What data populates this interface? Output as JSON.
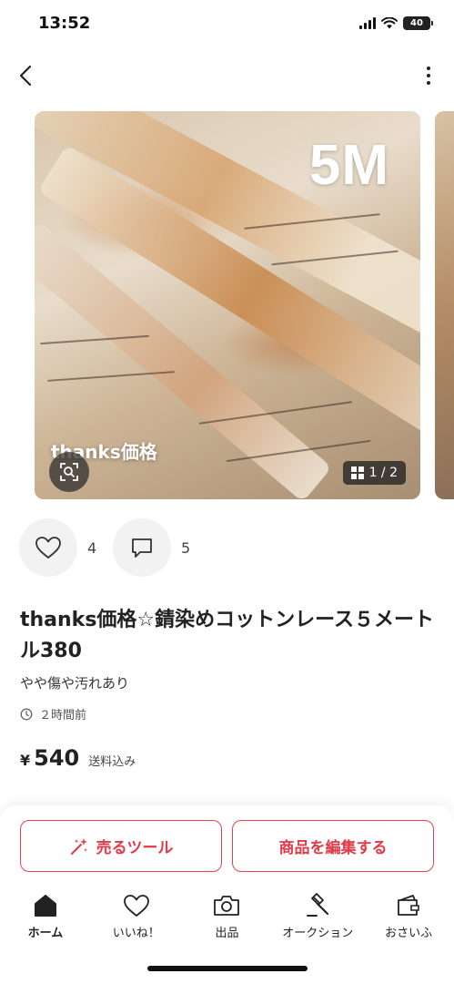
{
  "status_bar": {
    "time": "13:52",
    "battery": "40"
  },
  "product": {
    "photo_badge": "5M",
    "photo_caption": "thanks価格",
    "page_indicator": "1 / 2",
    "title": "thanks価格☆錆染めコットンレース５メートル380",
    "condition": "やや傷や汚れあり",
    "posted": "２時間前",
    "price_yen": "¥",
    "price_value": "540",
    "price_note": "送料込み"
  },
  "engagement": {
    "likes": "4",
    "comments": "5"
  },
  "buttons": {
    "sell_tool": "売るツール",
    "edit": "商品を編集する"
  },
  "tabbar": {
    "items": [
      {
        "label": "ホーム",
        "icon": "home-icon",
        "active": true
      },
      {
        "label": "いいね！",
        "icon": "heart-icon",
        "active": false
      },
      {
        "label": "出品",
        "icon": "camera-icon",
        "active": false
      },
      {
        "label": "オークション",
        "icon": "gavel-icon",
        "active": false
      },
      {
        "label": "おさいふ",
        "icon": "wallet-icon",
        "active": false
      }
    ]
  },
  "colors": {
    "accent": "#e23a48",
    "text": "#222222"
  }
}
